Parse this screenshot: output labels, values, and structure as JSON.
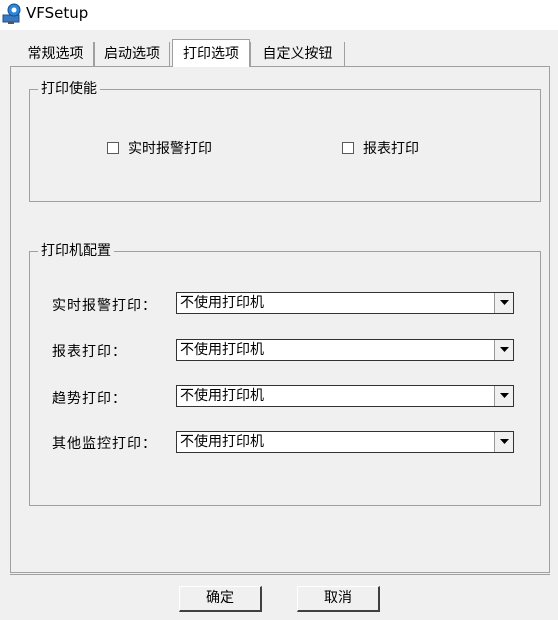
{
  "window": {
    "title": "VFSetup"
  },
  "tabs": [
    {
      "label": "常规选项"
    },
    {
      "label": "启动选项"
    },
    {
      "label": "打印选项"
    },
    {
      "label": "自定义按钮"
    }
  ],
  "print_enable": {
    "title": "打印使能",
    "realtime_alarm_print": {
      "label": "实时报警打印",
      "checked": false
    },
    "report_print": {
      "label": "报表打印",
      "checked": false
    }
  },
  "printer_config": {
    "title": "打印机配置",
    "rows": [
      {
        "label": "实时报警打印：",
        "value": "不使用打印机"
      },
      {
        "label": "报表打印：",
        "value": "不使用打印机"
      },
      {
        "label": "趋势打印：",
        "value": "不使用打印机"
      },
      {
        "label": "其他监控打印：",
        "value": "不使用打印机"
      }
    ]
  },
  "buttons": {
    "ok": "确定",
    "cancel": "取消"
  },
  "icons": {
    "app": "app-computer-icon",
    "dropdown": "chevron-down-icon"
  }
}
